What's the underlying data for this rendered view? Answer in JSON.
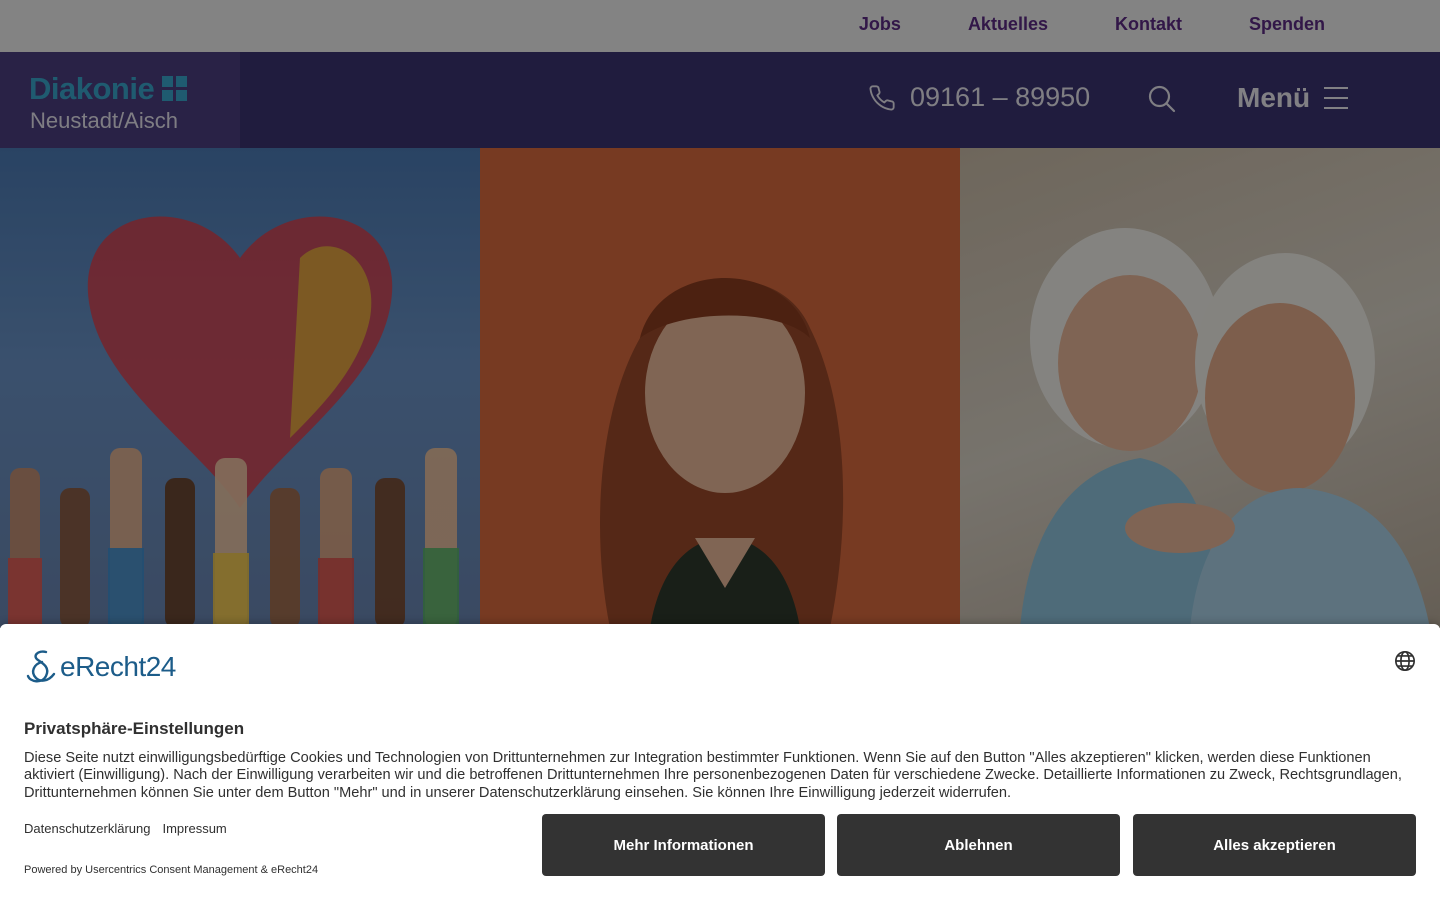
{
  "topnav": {
    "items": [
      {
        "label": "Jobs"
      },
      {
        "label": "Aktuelles"
      },
      {
        "label": "Kontakt"
      },
      {
        "label": "Spenden"
      }
    ]
  },
  "header": {
    "logo_main": "Diakonie",
    "logo_sub": "Neustadt/Aisch",
    "phone": "09161 – 89950",
    "menu_label": "Menü",
    "icons": {
      "phone": "phone-icon",
      "search": "search-icon",
      "menu": "hamburger-icon"
    }
  },
  "colors": {
    "topbar_bg": "#eeeeee",
    "topnav_text": "#5b2a84",
    "header_bg": "#3b3471",
    "logo_accent": "#3aa7cc",
    "button_bg": "#333333"
  },
  "consent": {
    "brand": "eRecht24",
    "title": "Privatsphäre-Einstellungen",
    "text": "Diese Seite nutzt einwilligungsbedürftige Cookies und Technologien von Drittunternehmen zur Integration bestimmter Funktionen. Wenn Sie auf den Button \"Alles akzeptieren\" klicken, werden diese Funktionen aktiviert (Einwilligung). Nach der Einwilligung verarbeiten wir und die betroffenen Drittunternehmen Ihre personenbezogenen Daten für verschiedene Zwecke. Detaillierte Informationen zu Zweck, Rechtsgrundlagen, Drittunternehmen können Sie unter dem Button \"Mehr\" und in unserer Datenschutzerklärung einsehen. Sie können Ihre Einwilligung jederzeit widerrufen.",
    "links": {
      "privacy": "Datenschutzerklärung",
      "imprint": "Impressum"
    },
    "powered": "Powered by Usercentrics Consent Management & eRecht24",
    "buttons": {
      "more": "Mehr Informationen",
      "decline": "Ablehnen",
      "accept": "Alles akzeptieren"
    }
  }
}
